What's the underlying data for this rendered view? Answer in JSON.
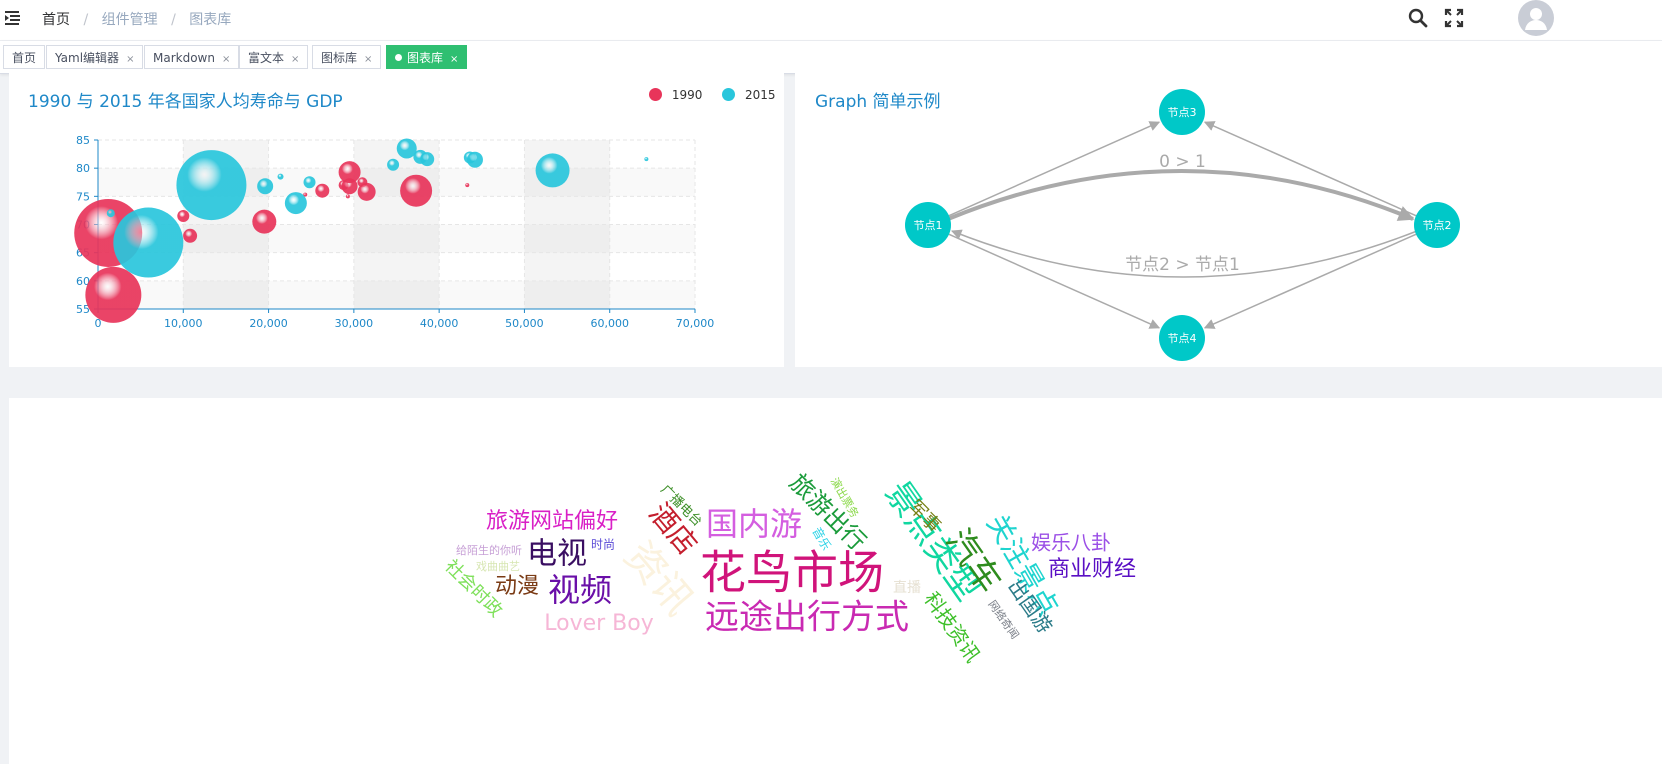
{
  "breadcrumb": {
    "home": "首页",
    "sep1": "/",
    "parent": "组件管理",
    "sep2": "/",
    "current": "图表库"
  },
  "tabs": [
    {
      "label": "首页",
      "closable": false
    },
    {
      "label": "Yaml编辑器",
      "closable": true
    },
    {
      "label": "Markdown",
      "closable": true
    },
    {
      "label": "富文本",
      "closable": true
    },
    {
      "label": "图标库",
      "closable": true
    },
    {
      "label": "图表库",
      "closable": true,
      "active": true
    }
  ],
  "tab_close_glyph": "×",
  "icons": {
    "menu": "menu-fold-icon",
    "search": "search-icon",
    "fullscreen": "fullscreen-icon",
    "avatar": "user-avatar-icon"
  },
  "colors": {
    "accent": "#2fbf71",
    "series1990": "#e8345a",
    "series2015": "#29c6dc",
    "graphNode": "#00c8c8"
  },
  "chart_data": [
    {
      "type": "scatter",
      "title": "1990 与 2015 年各国家人均寿命与 GDP",
      "xlabel": "",
      "ylabel": "",
      "xlim": [
        0,
        70000
      ],
      "ylim": [
        55,
        85
      ],
      "x_ticks": [
        "0",
        "10,000",
        "20,000",
        "30,000",
        "40,000",
        "50,000",
        "60,000",
        "70,000"
      ],
      "y_ticks": [
        "55",
        "60",
        "65",
        "70",
        "75",
        "80",
        "85"
      ],
      "grid": true,
      "legend": "top-right",
      "series": [
        {
          "name": "1990",
          "color": "#e8345a",
          "points": [
            {
              "x": 1200,
              "y": 68.5,
              "size": 34
            },
            {
              "x": 1800,
              "y": 57.5,
              "size": 28
            },
            {
              "x": 10000,
              "y": 71.5,
              "size": 6
            },
            {
              "x": 10800,
              "y": 68,
              "size": 7
            },
            {
              "x": 19500,
              "y": 70.5,
              "size": 12
            },
            {
              "x": 24300,
              "y": 75.3,
              "size": 2
            },
            {
              "x": 26300,
              "y": 76,
              "size": 7
            },
            {
              "x": 28800,
              "y": 77,
              "size": 5
            },
            {
              "x": 29500,
              "y": 76.8,
              "size": 8
            },
            {
              "x": 29500,
              "y": 79.3,
              "size": 11
            },
            {
              "x": 29300,
              "y": 75,
              "size": 2
            },
            {
              "x": 31000,
              "y": 77.5,
              "size": 5
            },
            {
              "x": 31500,
              "y": 75.8,
              "size": 9
            },
            {
              "x": 37300,
              "y": 76,
              "size": 16
            },
            {
              "x": 43300,
              "y": 77,
              "size": 2
            }
          ]
        },
        {
          "name": "2015",
          "color": "#29c6dc",
          "points": [
            {
              "x": 1500,
              "y": 72,
              "size": 4
            },
            {
              "x": 5900,
              "y": 66.8,
              "size": 35
            },
            {
              "x": 13300,
              "y": 77,
              "size": 35
            },
            {
              "x": 19600,
              "y": 76.8,
              "size": 8
            },
            {
              "x": 21400,
              "y": 78.5,
              "size": 3
            },
            {
              "x": 23200,
              "y": 73.8,
              "size": 11
            },
            {
              "x": 24800,
              "y": 77.5,
              "size": 6
            },
            {
              "x": 34600,
              "y": 80.6,
              "size": 6
            },
            {
              "x": 36200,
              "y": 83.5,
              "size": 10
            },
            {
              "x": 37800,
              "y": 82,
              "size": 7
            },
            {
              "x": 38600,
              "y": 81.6,
              "size": 7
            },
            {
              "x": 43600,
              "y": 81.9,
              "size": 6
            },
            {
              "x": 44200,
              "y": 81.5,
              "size": 8
            },
            {
              "x": 53300,
              "y": 79.6,
              "size": 17
            },
            {
              "x": 64300,
              "y": 81.6,
              "size": 2
            }
          ]
        }
      ]
    },
    {
      "type": "graph",
      "title": "Graph 简单示例",
      "nodes": [
        {
          "id": "n1",
          "label": "节点1"
        },
        {
          "id": "n2",
          "label": "节点2"
        },
        {
          "id": "n3",
          "label": "节点3"
        },
        {
          "id": "n4",
          "label": "节点4"
        }
      ],
      "edges": [
        {
          "from": "n1",
          "to": "n2",
          "label": "0 > 1",
          "bold": true
        },
        {
          "from": "n2",
          "to": "n1",
          "label": "节点2 > 节点1"
        },
        {
          "from": "n1",
          "to": "n3"
        },
        {
          "from": "n2",
          "to": "n3"
        },
        {
          "from": "n1",
          "to": "n4"
        },
        {
          "from": "n2",
          "to": "n4"
        }
      ]
    },
    {
      "type": "wordcloud",
      "words": [
        {
          "text": "花鸟市场",
          "color": "#d0137a"
        },
        {
          "text": "远途出行方式",
          "color": "#c92ab2"
        },
        {
          "text": "国内游",
          "color": "#d45ee0"
        },
        {
          "text": "旅游网站偏好",
          "color": "#d91fc6"
        },
        {
          "text": "酒店",
          "color": "#c41e2d"
        },
        {
          "text": "电视",
          "color": "#3a0e62"
        },
        {
          "text": "视频",
          "color": "#6a0fa8"
        },
        {
          "text": "动漫",
          "color": "#7a3a14"
        },
        {
          "text": "Lover Boy",
          "color": "#f6b6d6"
        },
        {
          "text": "资讯",
          "color": "#fbf2de"
        },
        {
          "text": "旅游出行",
          "color": "#1a9b3a"
        },
        {
          "text": "景点类型",
          "color": "#10d7a0"
        },
        {
          "text": "军事",
          "color": "#767f14"
        },
        {
          "text": "汽车",
          "color": "#2e8c1e"
        },
        {
          "text": "关注景点",
          "color": "#1ed4cf"
        },
        {
          "text": "娱乐八卦",
          "color": "#9b4fe6"
        },
        {
          "text": "商业财经",
          "color": "#5a0fc4"
        },
        {
          "text": "出国游",
          "color": "#2a7b88"
        },
        {
          "text": "科技资讯",
          "color": "#3ec02a"
        },
        {
          "text": "社会时政",
          "color": "#7ee05a"
        },
        {
          "text": "广播电台",
          "color": "#3d8f28"
        },
        {
          "text": "演出票务",
          "color": "#8bd94a"
        },
        {
          "text": "音乐",
          "color": "#29d2e6"
        },
        {
          "text": "时尚",
          "color": "#5a4ad6"
        },
        {
          "text": "给陌生的你听",
          "color": "#c7a0d6"
        },
        {
          "text": "戏曲曲艺",
          "color": "#d7e6b2"
        },
        {
          "text": "直播",
          "color": "#e6e0d2"
        },
        {
          "text": "网络奇闻",
          "color": "#7a7f88"
        }
      ]
    }
  ]
}
